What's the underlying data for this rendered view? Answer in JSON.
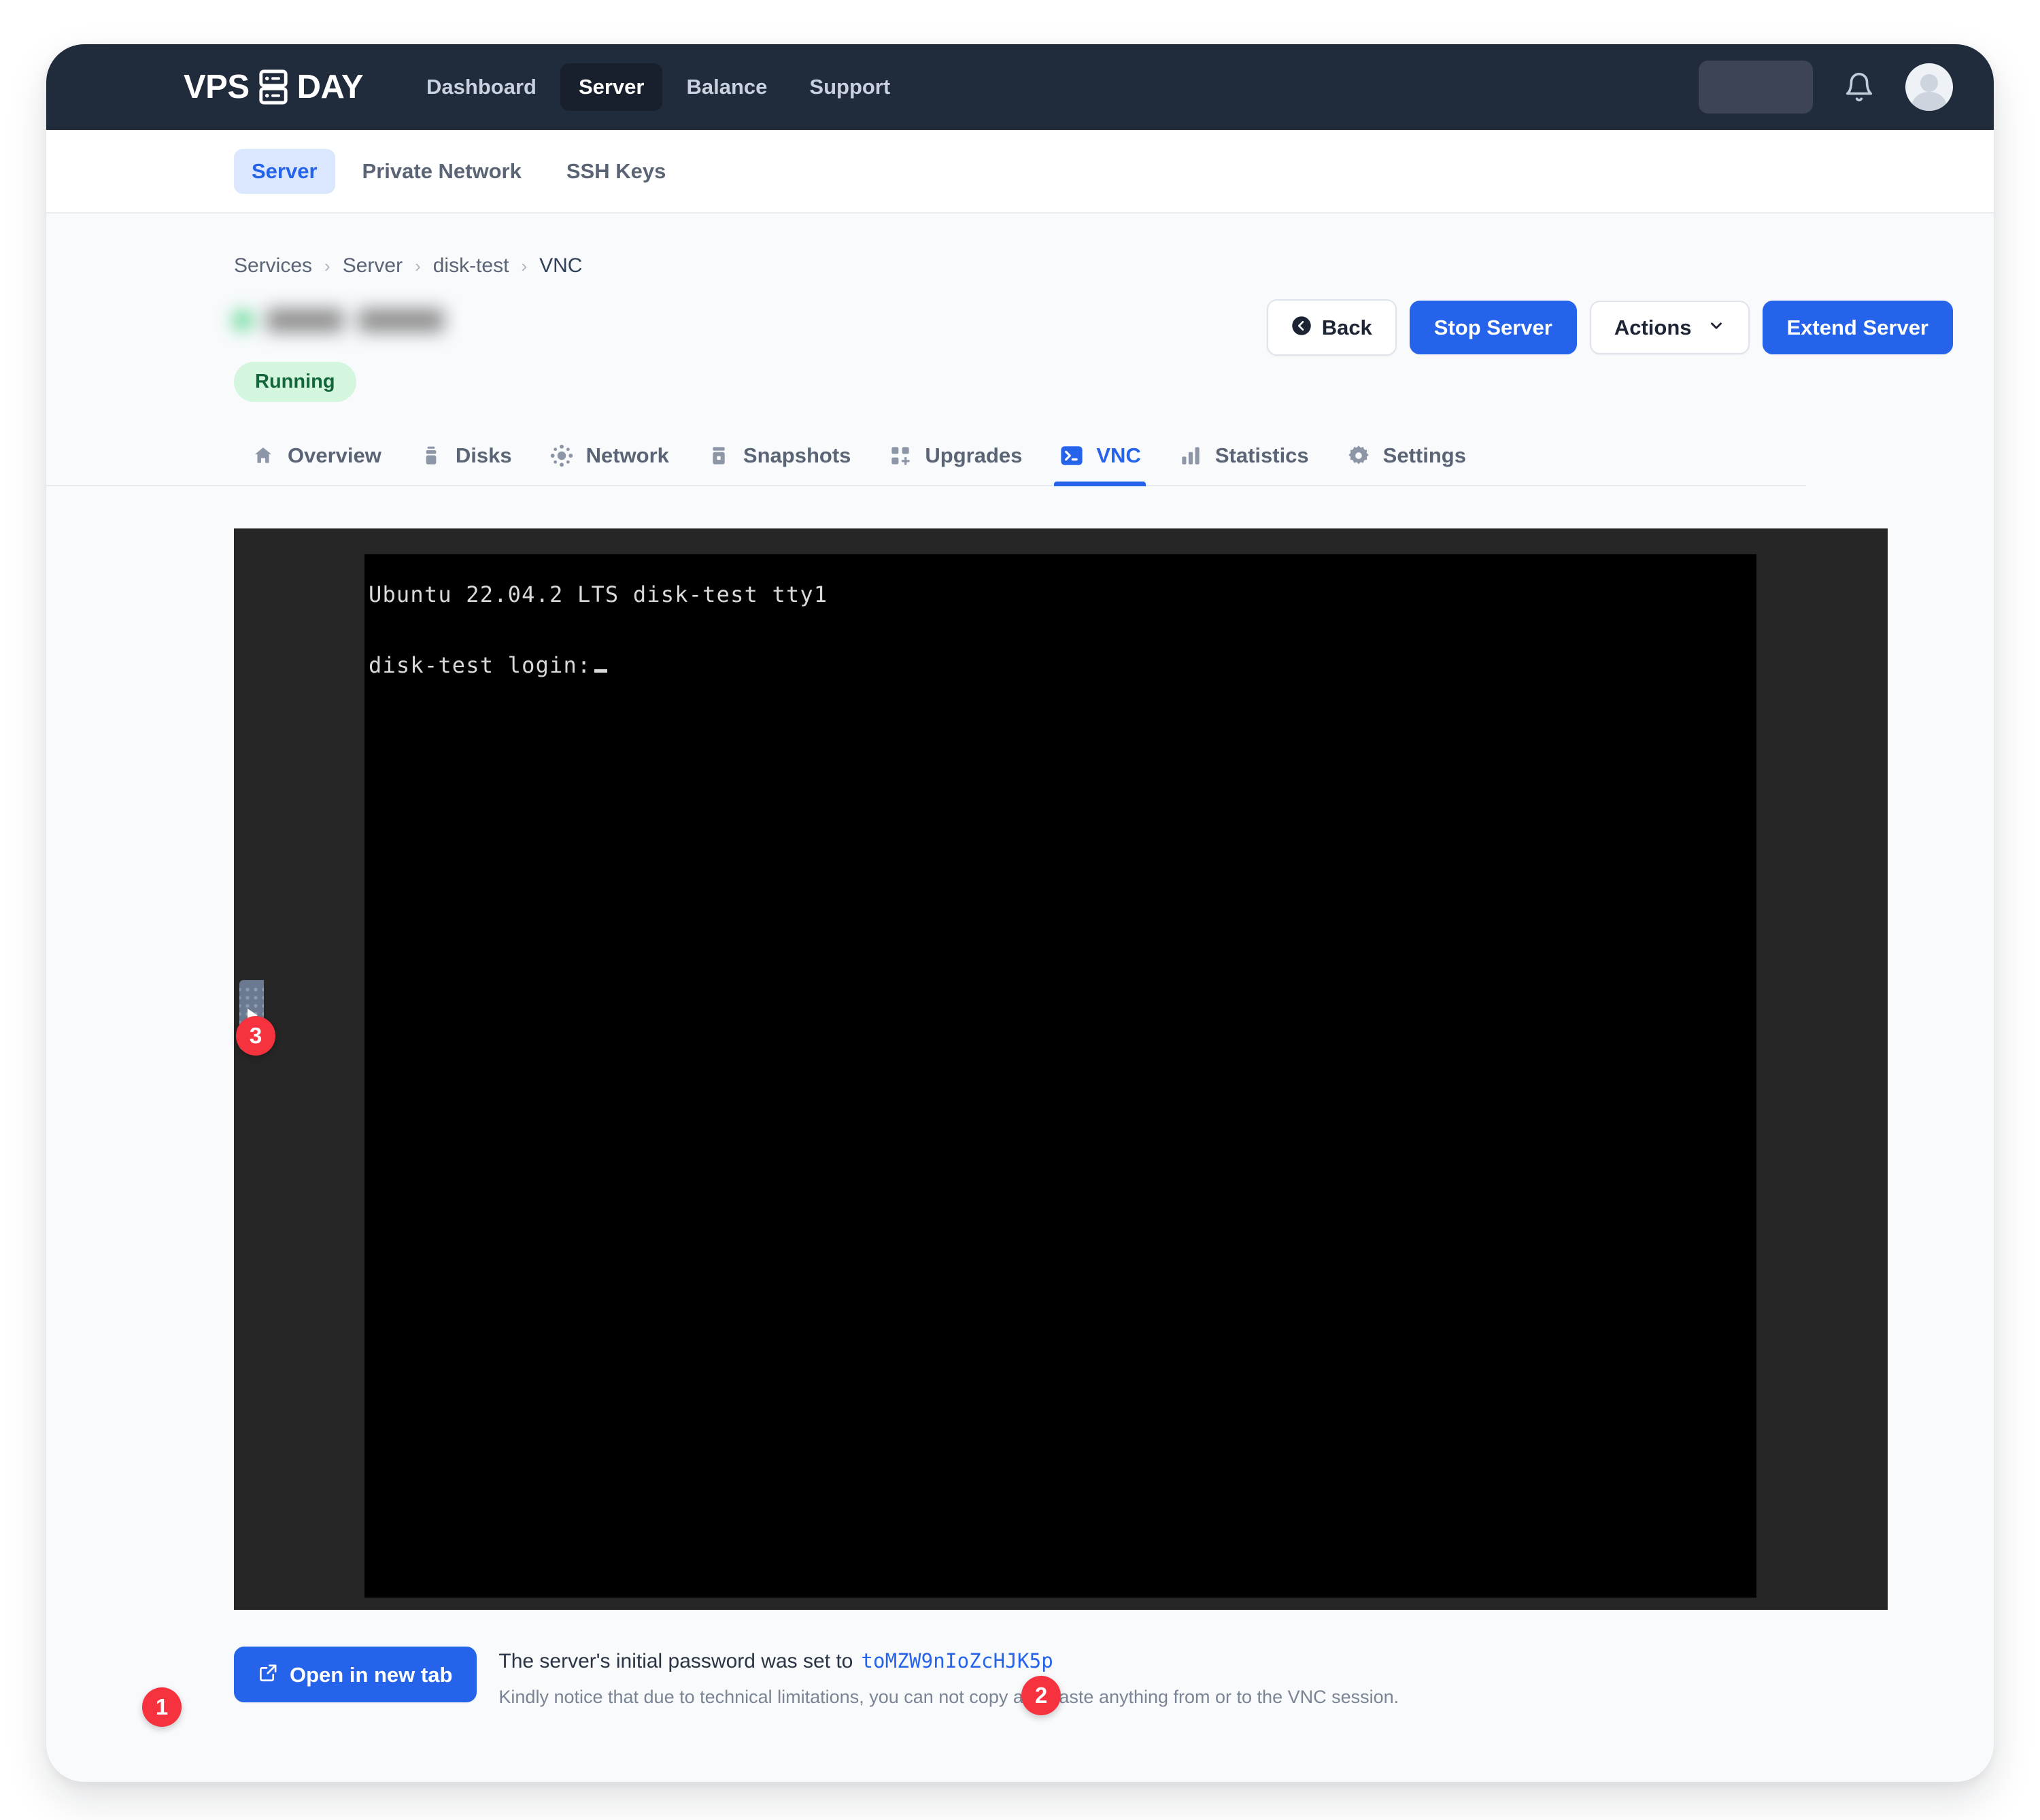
{
  "navbar": {
    "brand_left": "VPS",
    "brand_right": "DAY",
    "brand_icon": "server-rack-icon",
    "links": [
      {
        "label": "Dashboard",
        "active": false
      },
      {
        "label": "Server",
        "active": true
      },
      {
        "label": "Balance",
        "active": false
      },
      {
        "label": "Support",
        "active": false
      }
    ],
    "redacted_field": "",
    "bell_icon": "bell-icon",
    "avatar_icon": "user-avatar-icon"
  },
  "subnav": {
    "items": [
      {
        "label": "Server",
        "active": true
      },
      {
        "label": "Private Network",
        "active": false
      },
      {
        "label": "SSH Keys",
        "active": false
      }
    ]
  },
  "breadcrumb": {
    "items": [
      "Services",
      "Server",
      "disk-test",
      "VNC"
    ],
    "separator": "›"
  },
  "header": {
    "server_name_redacted": "",
    "status_label": "Running",
    "status_color": "#13663a",
    "status_bg": "#d4f6df"
  },
  "actions": {
    "back_label": "Back",
    "back_icon": "arrow-left-circle-icon",
    "stop_label": "Stop Server",
    "actions_label": "Actions",
    "actions_icon": "chevron-down-icon",
    "extend_label": "Extend Server",
    "primary_color": "#2563eb"
  },
  "tabs": [
    {
      "label": "Overview",
      "icon": "home-icon",
      "active": false
    },
    {
      "label": "Disks",
      "icon": "disk-icon",
      "active": false
    },
    {
      "label": "Network",
      "icon": "network-icon",
      "active": false
    },
    {
      "label": "Snapshots",
      "icon": "snapshot-icon",
      "active": false
    },
    {
      "label": "Upgrades",
      "icon": "upgrades-icon",
      "active": false
    },
    {
      "label": "VNC",
      "icon": "terminal-icon",
      "active": true
    },
    {
      "label": "Statistics",
      "icon": "bar-chart-icon",
      "active": false
    },
    {
      "label": "Settings",
      "icon": "gear-icon",
      "active": false
    }
  ],
  "vnc": {
    "line1": "Ubuntu 22.04.2 LTS disk-test tty1",
    "line2": "disk-test login:",
    "cursor": "_",
    "handle_icon": "drawer-handle-icon",
    "canvas_bg": "#000000",
    "frame_bg": "#262626"
  },
  "footer": {
    "open_button_label": "Open in new tab",
    "open_button_icon": "external-link-icon",
    "password_text": "The server's initial password was set to",
    "password_value": "toMZW9nIoZcHJK5p",
    "notice": "Kindly notice that due to technical limitations, you can not copy and paste anything from or to the VNC session."
  },
  "annotations": [
    {
      "id": "1",
      "label": "1"
    },
    {
      "id": "2",
      "label": "2"
    },
    {
      "id": "3",
      "label": "3"
    }
  ]
}
